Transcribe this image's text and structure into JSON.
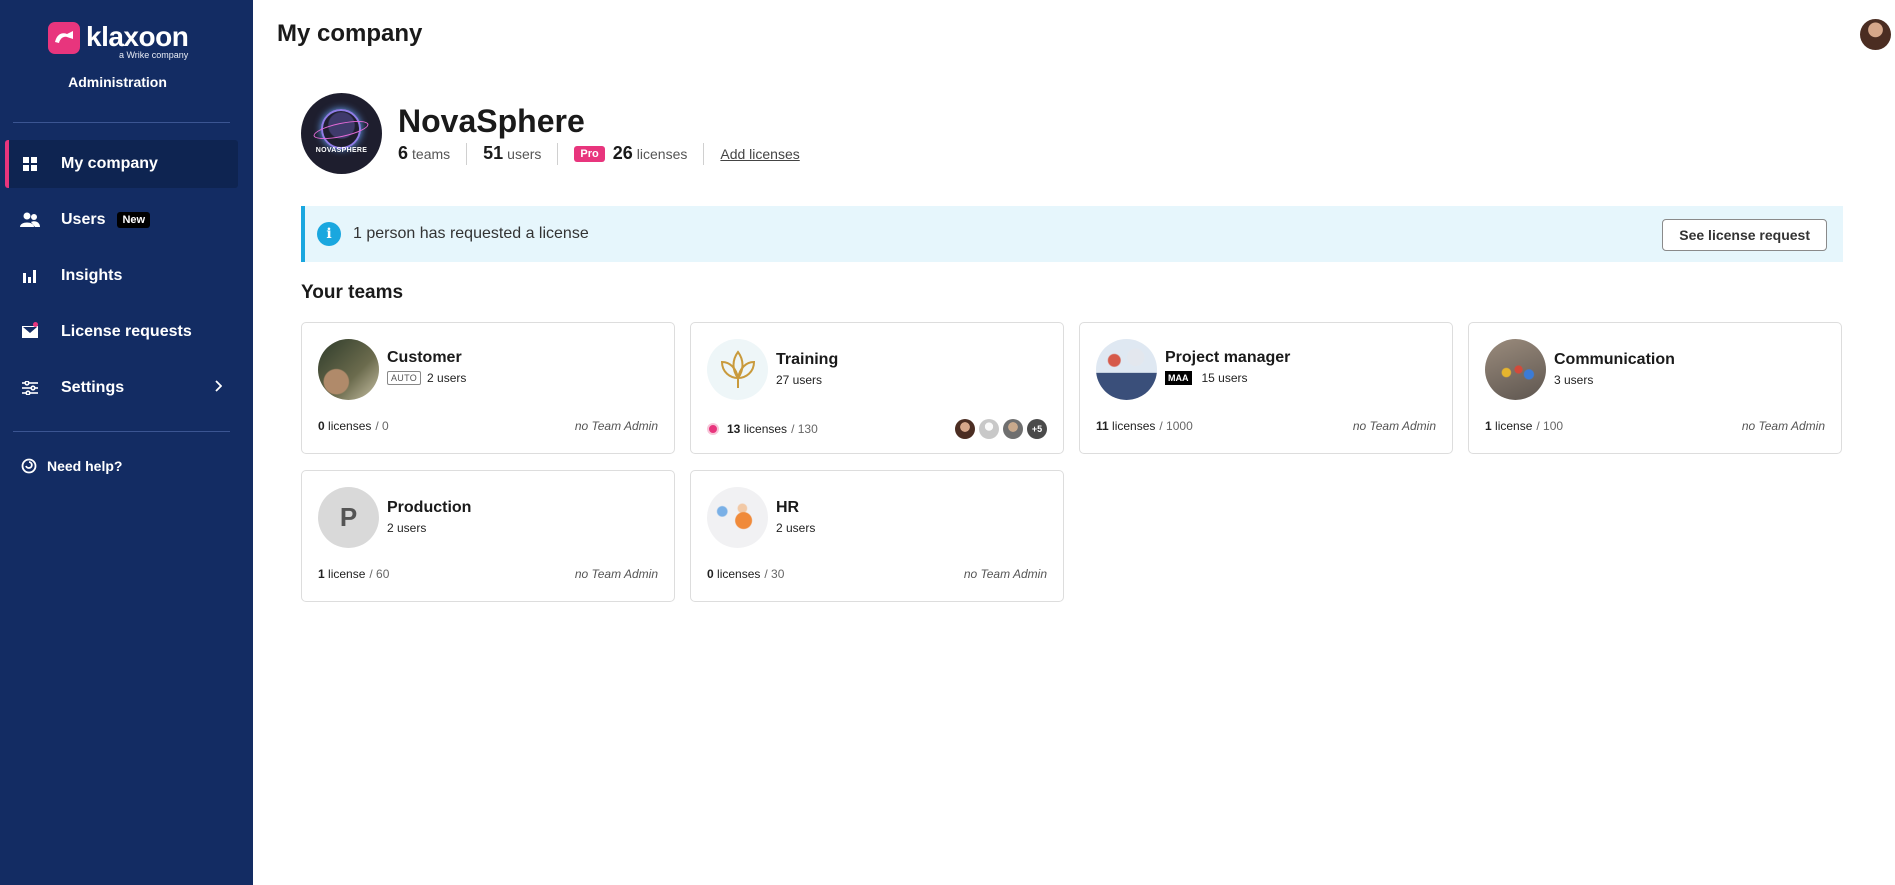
{
  "sidebar": {
    "brand_name": "klaxoon",
    "brand_sub": "a Wrike company",
    "section_label": "Administration",
    "items": [
      {
        "label": "My company",
        "icon": "grid-icon"
      },
      {
        "label": "Users",
        "icon": "users-icon",
        "badge": "New"
      },
      {
        "label": "Insights",
        "icon": "bar-chart-icon"
      },
      {
        "label": "License requests",
        "icon": "mail-icon"
      },
      {
        "label": "Settings",
        "icon": "sliders-icon"
      }
    ],
    "help_label": "Need help?"
  },
  "header": {
    "title": "My company"
  },
  "company": {
    "name": "NovaSphere",
    "logo_text": "NOVASPHERE",
    "teams_count": "6",
    "teams_label": "teams",
    "users_count": "51",
    "users_label": "users",
    "plan_badge": "Pro",
    "licenses_count": "26",
    "licenses_label": "licenses",
    "add_licenses_label": "Add licenses"
  },
  "banner": {
    "icon": "info-icon",
    "text": "1 person has requested a license",
    "button_label": "See license request"
  },
  "teams_section_title": "Your teams",
  "teams": [
    {
      "name": "Customer",
      "tag": "AUTO",
      "users": "2 users",
      "licenses": "0",
      "licenses_word": "licenses",
      "max": "/ 0",
      "admin": "no Team Admin"
    },
    {
      "name": "Training",
      "users": "27 users",
      "licenses": "13",
      "licenses_word": "licenses",
      "max": "/ 130",
      "more_members": "+5"
    },
    {
      "name": "Project manager",
      "tag": "MAA",
      "users": "15 users",
      "licenses": "11",
      "licenses_word": "licenses",
      "max": "/ 1000",
      "admin": "no Team Admin"
    },
    {
      "name": "Communication",
      "users": "3 users",
      "licenses": "1",
      "licenses_word": "license",
      "max": "/ 100",
      "admin": "no Team Admin"
    },
    {
      "name": "Production",
      "initial": "P",
      "users": "2 users",
      "licenses": "1",
      "licenses_word": "license",
      "max": "/ 60",
      "admin": "no Team Admin"
    },
    {
      "name": "HR",
      "users": "2 users",
      "licenses": "0",
      "licenses_word": "licenses",
      "max": "/ 30",
      "admin": "no Team Admin"
    }
  ],
  "colors": {
    "sidebar_bg": "#132c63",
    "accent": "#e8357d",
    "info": "#1aa7df",
    "banner_bg": "#e6f6fc"
  }
}
